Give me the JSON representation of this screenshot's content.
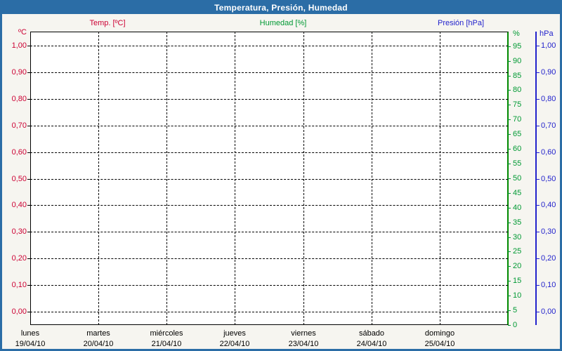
{
  "window": {
    "title": "Temperatura, Presión, Humedad"
  },
  "legend": {
    "items": [
      {
        "label": "Temp. [ºC]",
        "color": "#cc0033"
      },
      {
        "label": "Humedad [%]",
        "color": "#009933"
      },
      {
        "label": "Presión [hPa]",
        "color": "#2222cc"
      }
    ]
  },
  "chart_data": {
    "type": "line",
    "title": "Temperatura, Presión, Humedad",
    "grid": true,
    "plot_background": "#ffffff",
    "series": [
      {
        "name": "Temp. [ºC]",
        "axis": "temperature",
        "color": "#cc0033",
        "values": []
      },
      {
        "name": "Humedad [%]",
        "axis": "humidity",
        "color": "#009933",
        "values": []
      },
      {
        "name": "Presión [hPa]",
        "axis": "pressure",
        "color": "#2222cc",
        "values": []
      }
    ],
    "axes": {
      "temperature": {
        "label": "ºC",
        "color": "#cc0033",
        "side": "left",
        "min": 0,
        "max": 1,
        "step": 0.1,
        "ticks": [
          "1,00",
          "0,90",
          "0,80",
          "0,70",
          "0,60",
          "0,50",
          "0,40",
          "0,30",
          "0,20",
          "0,10",
          "0,00"
        ]
      },
      "humidity": {
        "label": "%",
        "color": "#009933",
        "side": "right",
        "min": 0,
        "max": 100,
        "step": 5,
        "ticks": [
          "0",
          "5",
          "10",
          "15",
          "20",
          "25",
          "30",
          "35",
          "40",
          "45",
          "50",
          "55",
          "60",
          "65",
          "70",
          "75",
          "80",
          "85",
          "90",
          "95"
        ]
      },
      "pressure": {
        "label": "hPa",
        "color": "#2222cc",
        "side": "far-right",
        "min": 0,
        "max": 1,
        "step": 0.1,
        "ticks": [
          "1,00",
          "0,90",
          "0,80",
          "0,70",
          "0,60",
          "0,50",
          "0,40",
          "0,30",
          "0,20",
          "0,10",
          "0,00"
        ]
      }
    },
    "x_axis": {
      "days": [
        {
          "name": "lunes",
          "date": "19/04/10"
        },
        {
          "name": "martes",
          "date": "20/04/10"
        },
        {
          "name": "miércoles",
          "date": "21/04/10"
        },
        {
          "name": "jueves",
          "date": "22/04/10"
        },
        {
          "name": "viernes",
          "date": "23/04/10"
        },
        {
          "name": "sábado",
          "date": "24/04/10"
        },
        {
          "name": "domingo",
          "date": "25/04/10"
        }
      ]
    }
  },
  "colors": {
    "frame": "#2b6da6",
    "title_bar": "#2b6da6",
    "background": "#f6f5f0",
    "grid": "#000000",
    "temperature": "#cc0033",
    "humidity": "#009933",
    "pressure": "#2222cc"
  }
}
